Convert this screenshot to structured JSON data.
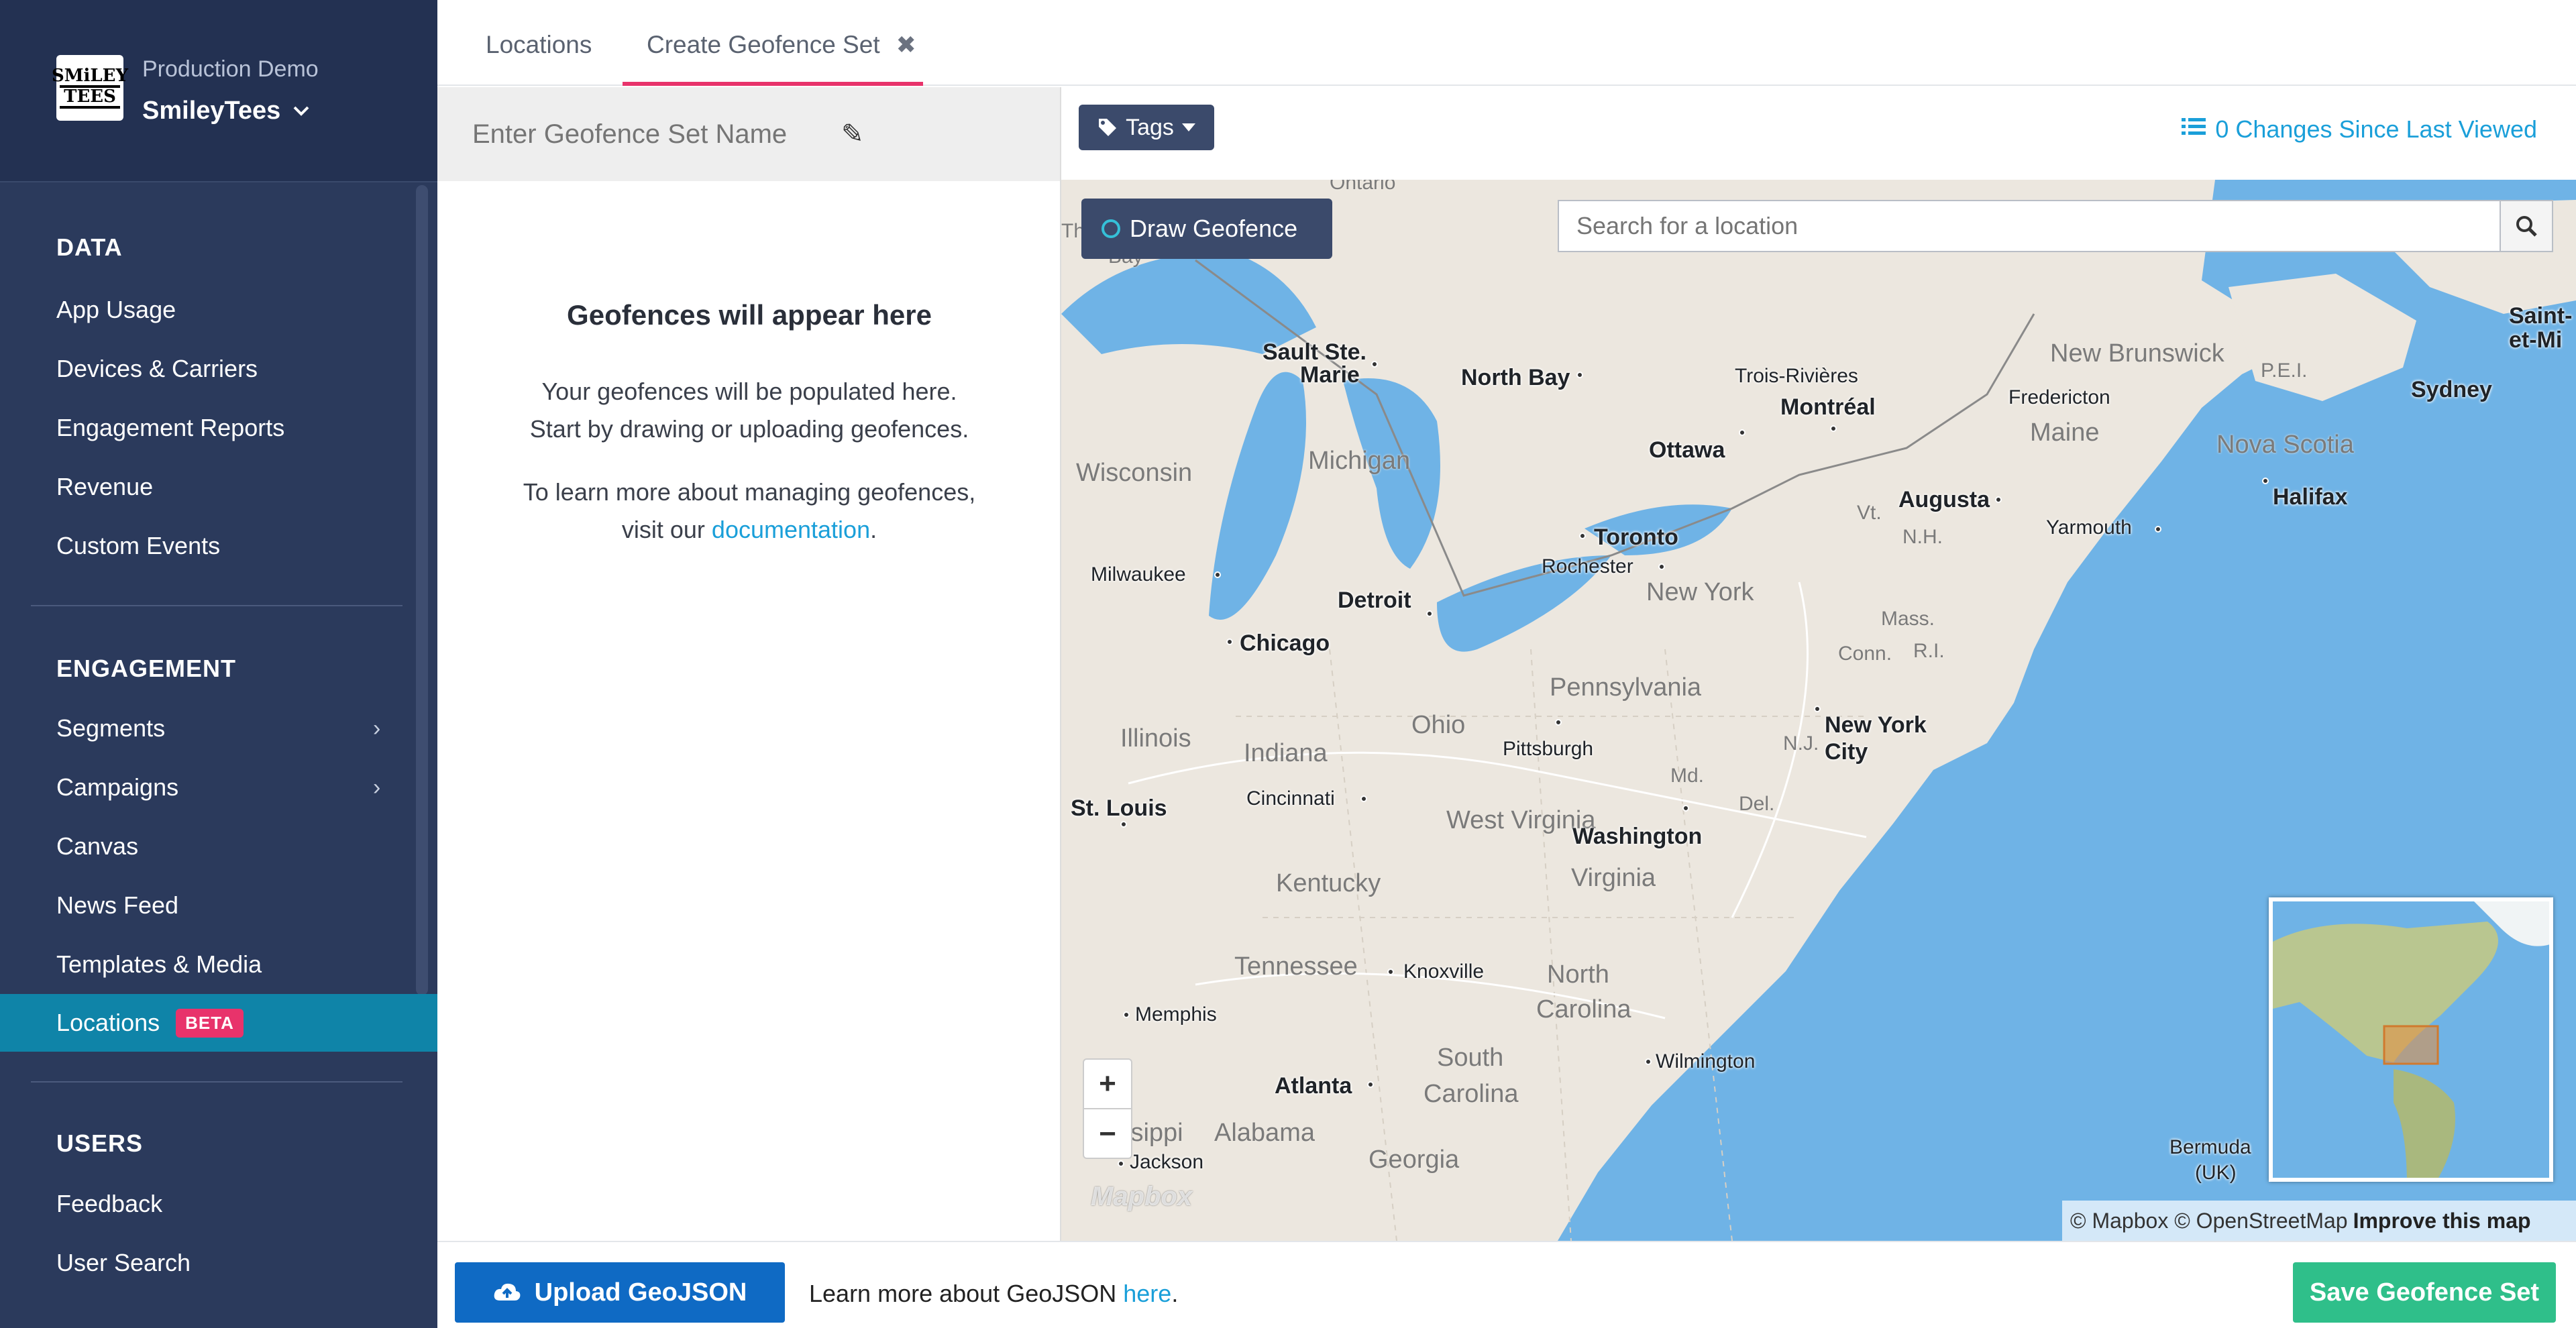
{
  "sidebar": {
    "org_subtitle": "Production Demo",
    "org_name": "SmileyTees",
    "logo_line1": "SMiLEY",
    "logo_line2": "TEES",
    "sections": {
      "data": "DATA",
      "engagement": "ENGAGEMENT",
      "users": "USERS"
    },
    "data_items": [
      "App Usage",
      "Devices & Carriers",
      "Engagement Reports",
      "Revenue",
      "Custom Events"
    ],
    "engagement_items": [
      "Segments",
      "Campaigns",
      "Canvas",
      "News Feed",
      "Templates & Media"
    ],
    "active_item": "Locations",
    "active_badge": "BETA",
    "users_items": [
      "Feedback",
      "User Search"
    ]
  },
  "tabs": {
    "locations": "Locations",
    "create": "Create Geofence Set"
  },
  "name_bar": {
    "placeholder": "Enter Geofence Set Name"
  },
  "left_panel": {
    "title": "Geofences will appear here",
    "line1": "Your geofences will be populated here.",
    "line2": "Start by drawing or uploading geofences.",
    "line3": "To learn more about managing geofences,",
    "line4_prefix": "visit our",
    "line4_link": "documentation",
    "line4_suffix": "."
  },
  "toolbar": {
    "tags_label": "Tags",
    "changes_label": "0 Changes Since Last Viewed"
  },
  "map": {
    "draw_label": "Draw Geofence",
    "search_placeholder": "Search for a location",
    "zoom_in": "+",
    "zoom_out": "−",
    "logo_text": "Mapbox",
    "attribution": "© Mapbox © OpenStreetMap",
    "improve": "Improve this map",
    "cities": {
      "sault": "Sault Ste.",
      "marie": "Marie",
      "north_bay": "North Bay",
      "trois": "Trois-Rivières",
      "montreal": "Montréal",
      "fredericton": "Fredericton",
      "sydney": "Sydney",
      "ottawa": "Ottawa",
      "augusta": "Augusta",
      "halifax": "Halifax",
      "yarmouth": "Yarmouth",
      "toronto": "Toronto",
      "rochester": "Rochester",
      "milwaukee": "Milwaukee",
      "detroit": "Detroit",
      "chicago": "Chicago",
      "new_york": "New York",
      "city": "City",
      "pittsburgh": "Pittsburgh",
      "cincinnati": "Cincinnati",
      "st_louis": "St. Louis",
      "washington": "Washington",
      "knoxville": "Knoxville",
      "memphis": "Memphis",
      "wilmington": "Wilmington",
      "atlanta": "Atlanta",
      "jackson": "Jackson",
      "bermuda": "Bermuda",
      "uk": "(UK)",
      "saint": "Saint-",
      "etm": "et-Mi"
    },
    "regions": {
      "ontario": "Ontario",
      "wisconsin": "Wisconsin",
      "michigan": "Michigan",
      "new_brunswick": "New Brunswick",
      "pei": "P.E.I.",
      "maine": "Maine",
      "nova_scotia": "Nova Scotia",
      "vt": "Vt.",
      "nh": "N.H.",
      "new_york_state": "New York",
      "mass": "Mass.",
      "conn": "Conn.",
      "ri": "R.I.",
      "pennsylvania": "Pennsylvania",
      "ohio": "Ohio",
      "illinois": "Illinois",
      "indiana": "Indiana",
      "nj": "N.J.",
      "md": "Md.",
      "del": "Del.",
      "west_virginia": "West Virginia",
      "virginia": "Virginia",
      "kentucky": "Kentucky",
      "tennessee": "Tennessee",
      "north": "North",
      "carolina": "Carolina",
      "south": "South",
      "south_carolina": "Carolina",
      "mississippi": "ssissippi",
      "alabama": "Alabama",
      "georgia": "Georgia",
      "th": "Th",
      "bay": "Bay"
    }
  },
  "bottom": {
    "upload_label": "Upload GeoJSON",
    "learn_prefix": "Learn more about GeoJSON",
    "learn_link": "here",
    "learn_suffix": ".",
    "save_label": "Save Geofence Set"
  }
}
